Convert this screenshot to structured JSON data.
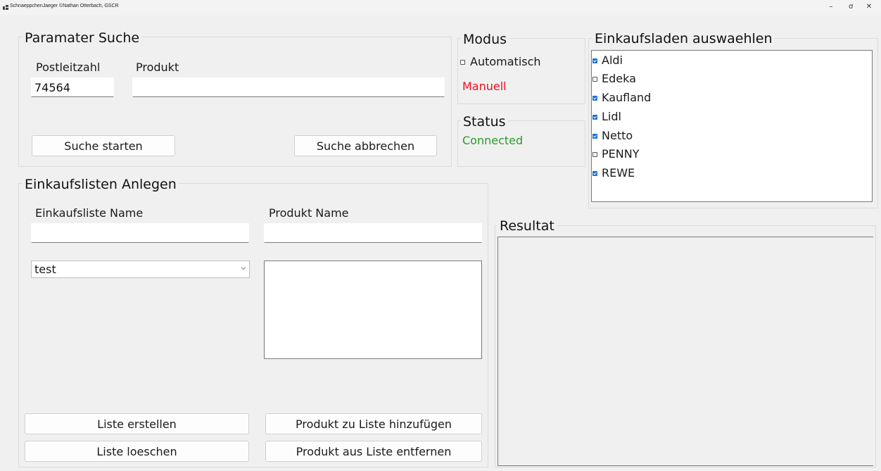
{
  "window": {
    "title": "SchnaeppchenJaeger ©Nathan Otterbach, GSCR",
    "minimize_glyph": "–",
    "restore_glyph": "ơ",
    "close_glyph": "✕"
  },
  "search": {
    "legend": "Paramater Suche",
    "postal_code_label": "Postleitzahl",
    "postal_code_value": "74564",
    "product_label": "Produkt",
    "product_value": "",
    "start_button": "Suche starten",
    "cancel_button": "Suche abbrechen"
  },
  "mode": {
    "legend": "Modus",
    "automatic_label": "Automatisch",
    "automatic_checked": false,
    "manual_text": "Manuell",
    "manual_color": "#e81123"
  },
  "status": {
    "legend": "Status",
    "text": "Connected",
    "color": "#2b9a2b"
  },
  "stores": {
    "legend": "Einkaufsladen auswaehlen",
    "accent": "#1f6fd0",
    "items": [
      {
        "name": "Aldi",
        "checked": true
      },
      {
        "name": "Edeka",
        "checked": false
      },
      {
        "name": "Kaufland",
        "checked": true
      },
      {
        "name": "Lidl",
        "checked": true
      },
      {
        "name": "Netto",
        "checked": true
      },
      {
        "name": "PENNY",
        "checked": false
      },
      {
        "name": "REWE",
        "checked": true
      }
    ]
  },
  "lists": {
    "legend": "Einkaufslisten Anlegen",
    "list_name_label": "Einkaufsliste Name",
    "list_name_value": "",
    "product_name_label": "Produkt Name",
    "product_name_value": "",
    "selected_list": "test",
    "create_button": "Liste erstellen",
    "delete_button": "Liste loeschen",
    "add_product_button": "Produkt zu Liste hinzufügen",
    "remove_product_button": "Produkt aus Liste entfernen"
  },
  "result": {
    "legend": "Resultat"
  }
}
